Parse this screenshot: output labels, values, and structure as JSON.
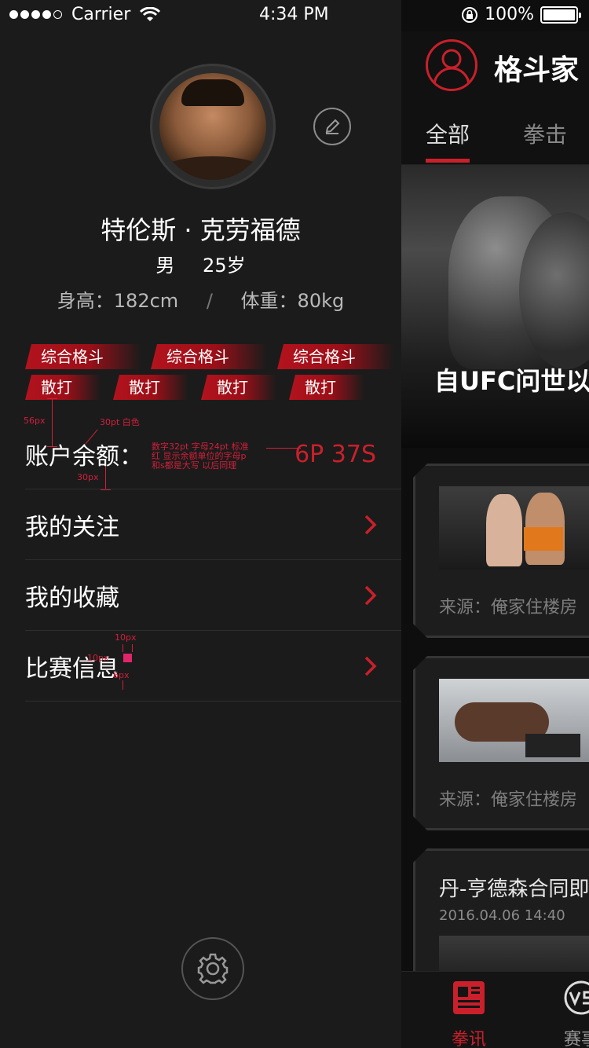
{
  "status_bar": {
    "carrier": "Carrier",
    "time": "4:34 PM",
    "battery": "100%"
  },
  "drawer": {
    "profile": {
      "name": "特伦斯 · 克劳福德",
      "gender": "男",
      "age": "25岁",
      "height": "身高：182cm",
      "separator": "/",
      "weight": "体重：80kg"
    },
    "tags_row1": [
      "综合格斗",
      "综合格斗",
      "综合格斗"
    ],
    "tags_row2": [
      "散打",
      "散打",
      "散打",
      "散打"
    ],
    "balance": {
      "label": "账户余额：",
      "value": "6P 37S"
    },
    "menu": [
      {
        "label": "我的关注"
      },
      {
        "label": "我的收藏"
      },
      {
        "label": "比赛信息"
      }
    ],
    "annotations": {
      "a1": "56px",
      "a2": "30pt 白色",
      "a3": "30px",
      "a4": "数字32pt 字母24pt 标准",
      "a5": "红 显示余额单位的字母p",
      "a6": "和s都是大写 以后同理",
      "a7": "10px",
      "a8": "10px",
      "a9": "6px"
    }
  },
  "main": {
    "app_title": "格斗家",
    "tabs": [
      "全部",
      "拳击"
    ],
    "active_tab_index": 0,
    "hero_caption": "自UFC问世以",
    "cards": [
      {
        "source": "来源：俺家住楼房"
      },
      {
        "source": "来源：俺家住楼房"
      },
      {
        "title": "丹-亨德森合同即",
        "date": "2016.04.06   14:40"
      }
    ],
    "bottom_nav": [
      {
        "label": "拳讯",
        "icon": "newspaper-icon",
        "active": true
      },
      {
        "label": "赛事",
        "icon": "vs-icon",
        "active": false
      }
    ]
  },
  "colors": {
    "accent": "#c9202b",
    "drawer_bg": "#1b1b1b",
    "main_bg": "#0e0e0e"
  }
}
